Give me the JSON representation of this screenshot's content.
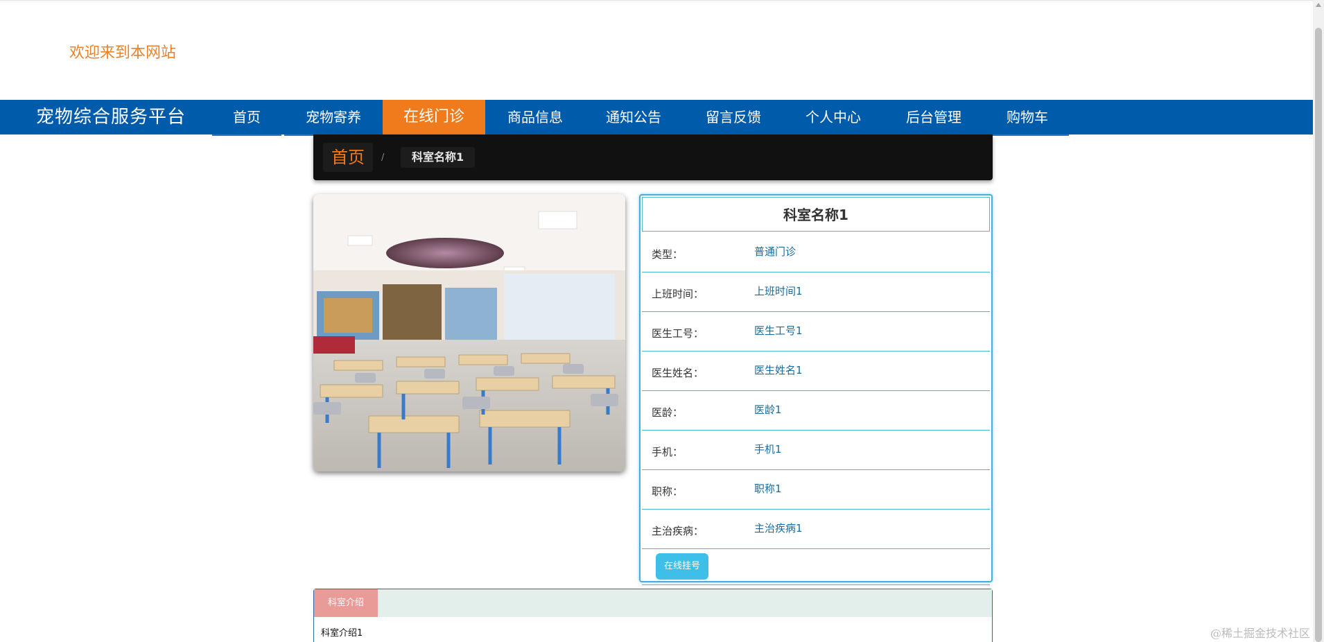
{
  "header": {
    "welcome": "欢迎来到本网站"
  },
  "nav": {
    "brand": "宠物综合服务平台",
    "items": [
      "首页",
      "宠物寄养",
      "在线门诊",
      "商品信息",
      "通知公告",
      "留言反馈",
      "个人中心",
      "后台管理",
      "购物车"
    ],
    "active_index": 2
  },
  "breadcrumb": {
    "home": "首页",
    "separator": "/",
    "current": "科室名称1"
  },
  "detail": {
    "title": "科室名称1",
    "rows": [
      {
        "label": "类型：",
        "value": "普通门诊"
      },
      {
        "label": "上班时间：",
        "value": "上班时间1"
      },
      {
        "label": "医生工号：",
        "value": "医生工号1"
      },
      {
        "label": "医生姓名：",
        "value": "医生姓名1"
      },
      {
        "label": "医龄：",
        "value": "医龄1"
      },
      {
        "label": "手机：",
        "value": "手机1"
      },
      {
        "label": "职称：",
        "value": "职称1"
      },
      {
        "label": "主治疾病：",
        "value": "主治疾病1"
      }
    ],
    "book_label": "在线挂号"
  },
  "intro": {
    "tab": "科室介绍",
    "text": "科室介绍1"
  },
  "watermark": "@稀土掘金技术社区",
  "colors": {
    "nav_bg": "#005bab",
    "accent": "#f07b1c",
    "detail_border": "#44aee0"
  }
}
